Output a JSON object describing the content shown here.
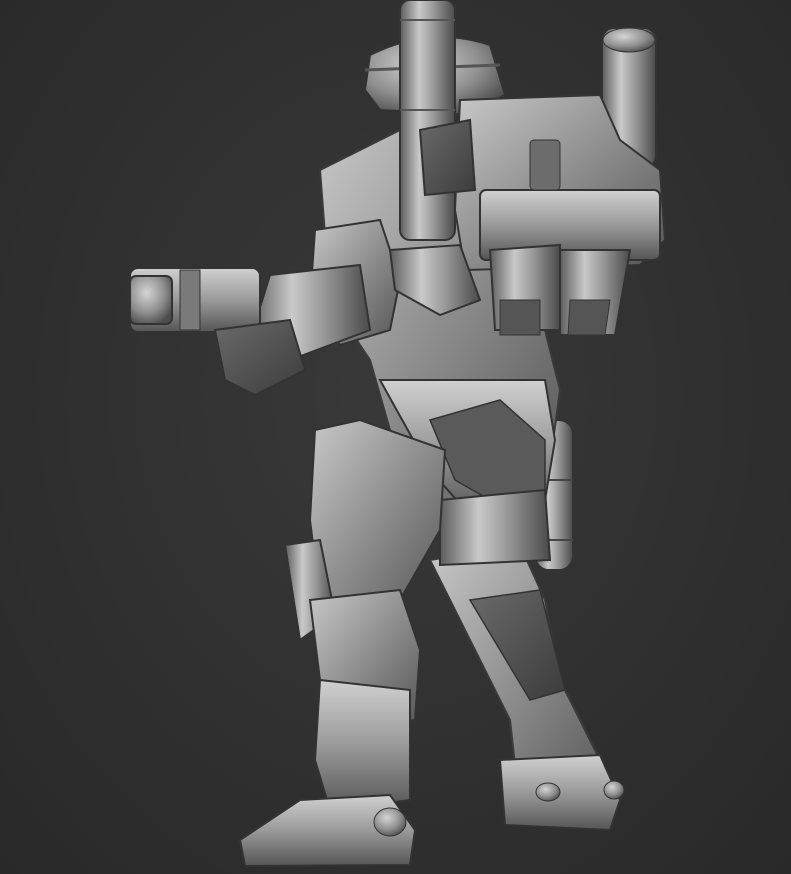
{
  "scene": {
    "background_color": "#2f2f2f",
    "material_color": "#9a9a9a",
    "highlight_color": "#d8d8d8",
    "shadow_color": "#3a3a3a"
  }
}
